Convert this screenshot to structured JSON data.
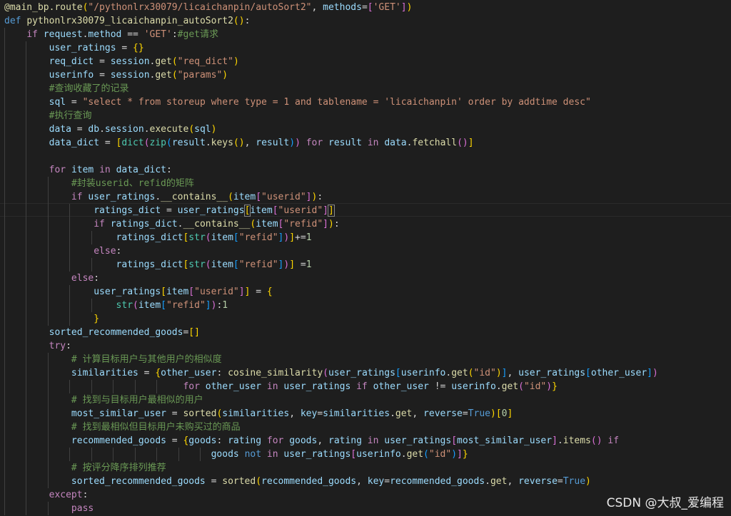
{
  "watermark": "CSDN @大叔_爱编程",
  "lines": [
    [
      [
        "dec",
        "@main_bp.route"
      ],
      [
        "bk1",
        "("
      ],
      [
        "str",
        "\"/pythonlrx30079/licaichanpin/autoSort2\""
      ],
      [
        "plain",
        ", "
      ],
      [
        "var",
        "methods"
      ],
      [
        "plain",
        "="
      ],
      [
        "bk2",
        "["
      ],
      [
        "str",
        "'GET'"
      ],
      [
        "bk2",
        "]"
      ],
      [
        "bk1",
        ")"
      ]
    ],
    [
      [
        "kw",
        "def "
      ],
      [
        "fn",
        "pythonlrx30079_licaichanpin_autoSort2"
      ],
      [
        "bk1",
        "()"
      ],
      [
        "plain",
        ":"
      ]
    ],
    [
      [
        "plain",
        "    "
      ],
      [
        "ctl",
        "if "
      ],
      [
        "var",
        "request"
      ],
      [
        "plain",
        "."
      ],
      [
        "var",
        "method"
      ],
      [
        "plain",
        " == "
      ],
      [
        "str",
        "'GET'"
      ],
      [
        "plain",
        ":"
      ],
      [
        "cmt",
        "#get请求"
      ]
    ],
    [
      [
        "plain",
        "        "
      ],
      [
        "var",
        "user_ratings"
      ],
      [
        "plain",
        " = "
      ],
      [
        "bk1",
        "{}"
      ]
    ],
    [
      [
        "plain",
        "        "
      ],
      [
        "var",
        "req_dict"
      ],
      [
        "plain",
        " = "
      ],
      [
        "var",
        "session"
      ],
      [
        "plain",
        "."
      ],
      [
        "fn",
        "get"
      ],
      [
        "bk1",
        "("
      ],
      [
        "str",
        "\"req_dict\""
      ],
      [
        "bk1",
        ")"
      ]
    ],
    [
      [
        "plain",
        "        "
      ],
      [
        "var",
        "userinfo"
      ],
      [
        "plain",
        " = "
      ],
      [
        "var",
        "session"
      ],
      [
        "plain",
        "."
      ],
      [
        "fn",
        "get"
      ],
      [
        "bk1",
        "("
      ],
      [
        "str",
        "\"params\""
      ],
      [
        "bk1",
        ")"
      ]
    ],
    [
      [
        "plain",
        "        "
      ],
      [
        "cmt",
        "#查询收藏了的记录"
      ]
    ],
    [
      [
        "plain",
        "        "
      ],
      [
        "var",
        "sql"
      ],
      [
        "plain",
        " = "
      ],
      [
        "str",
        "\"select * from storeup where type = 1 and tablename = 'licaichanpin' order by addtime desc\""
      ]
    ],
    [
      [
        "plain",
        "        "
      ],
      [
        "cmt",
        "#执行查询"
      ]
    ],
    [
      [
        "plain",
        "        "
      ],
      [
        "var",
        "data"
      ],
      [
        "plain",
        " = "
      ],
      [
        "var",
        "db"
      ],
      [
        "plain",
        "."
      ],
      [
        "var",
        "session"
      ],
      [
        "plain",
        "."
      ],
      [
        "fn",
        "execute"
      ],
      [
        "bk1",
        "("
      ],
      [
        "var",
        "sql"
      ],
      [
        "bk1",
        ")"
      ]
    ],
    [
      [
        "plain",
        "        "
      ],
      [
        "var",
        "data_dict"
      ],
      [
        "plain",
        " = "
      ],
      [
        "bk1",
        "["
      ],
      [
        "bi",
        "dict"
      ],
      [
        "bk2",
        "("
      ],
      [
        "bi",
        "zip"
      ],
      [
        "bk3",
        "("
      ],
      [
        "var",
        "result"
      ],
      [
        "plain",
        "."
      ],
      [
        "fn",
        "keys"
      ],
      [
        "bk1",
        "()"
      ],
      [
        "plain",
        ", "
      ],
      [
        "var",
        "result"
      ],
      [
        "bk3",
        ")"
      ],
      [
        "bk2",
        ")"
      ],
      [
        "plain",
        " "
      ],
      [
        "ctl",
        "for "
      ],
      [
        "var",
        "result"
      ],
      [
        "plain",
        " "
      ],
      [
        "ctl",
        "in "
      ],
      [
        "var",
        "data"
      ],
      [
        "plain",
        "."
      ],
      [
        "fn",
        "fetchall"
      ],
      [
        "bk2",
        "()"
      ],
      [
        "bk1",
        "]"
      ]
    ],
    [],
    [
      [
        "plain",
        "        "
      ],
      [
        "ctl",
        "for "
      ],
      [
        "var",
        "item"
      ],
      [
        "plain",
        " "
      ],
      [
        "ctl",
        "in "
      ],
      [
        "var",
        "data_dict"
      ],
      [
        "plain",
        ":"
      ]
    ],
    [
      [
        "plain",
        "            "
      ],
      [
        "cmt",
        "#封装userid、refid的矩阵"
      ]
    ],
    [
      [
        "plain",
        "            "
      ],
      [
        "ctl",
        "if "
      ],
      [
        "var",
        "user_ratings"
      ],
      [
        "plain",
        "."
      ],
      [
        "fn",
        "__contains__"
      ],
      [
        "bk1",
        "("
      ],
      [
        "var",
        "item"
      ],
      [
        "bk2",
        "["
      ],
      [
        "str",
        "\"userid\""
      ],
      [
        "bk2",
        "]"
      ],
      [
        "bk1",
        ")"
      ],
      [
        "plain",
        ":"
      ]
    ],
    [
      [
        "plain",
        "                "
      ],
      [
        "var",
        "ratings_dict"
      ],
      [
        "plain",
        " = "
      ],
      [
        "var",
        "user_ratings"
      ],
      [
        "bk1box",
        "["
      ],
      [
        "var",
        "item"
      ],
      [
        "bk2",
        "["
      ],
      [
        "str",
        "\"userid\""
      ],
      [
        "bk2",
        "]"
      ],
      [
        "bk1box",
        "]"
      ]
    ],
    [
      [
        "plain",
        "                "
      ],
      [
        "ctl",
        "if "
      ],
      [
        "var",
        "ratings_dict"
      ],
      [
        "plain",
        "."
      ],
      [
        "fn",
        "__contains__"
      ],
      [
        "bk1",
        "("
      ],
      [
        "var",
        "item"
      ],
      [
        "bk2",
        "["
      ],
      [
        "str",
        "\"refid\""
      ],
      [
        "bk2",
        "]"
      ],
      [
        "bk1",
        ")"
      ],
      [
        "plain",
        ":"
      ]
    ],
    [
      [
        "plain",
        "                    "
      ],
      [
        "var",
        "ratings_dict"
      ],
      [
        "bk1",
        "["
      ],
      [
        "bi",
        "str"
      ],
      [
        "bk2",
        "("
      ],
      [
        "var",
        "item"
      ],
      [
        "bk3",
        "["
      ],
      [
        "str",
        "\"refid\""
      ],
      [
        "bk3",
        "]"
      ],
      [
        "bk2",
        ")"
      ],
      [
        "bk1",
        "]"
      ],
      [
        "plain",
        "+="
      ],
      [
        "num",
        "1"
      ]
    ],
    [
      [
        "plain",
        "                "
      ],
      [
        "ctl",
        "else"
      ],
      [
        "plain",
        ":"
      ]
    ],
    [
      [
        "plain",
        "                    "
      ],
      [
        "var",
        "ratings_dict"
      ],
      [
        "bk1",
        "["
      ],
      [
        "bi",
        "str"
      ],
      [
        "bk2",
        "("
      ],
      [
        "var",
        "item"
      ],
      [
        "bk3",
        "["
      ],
      [
        "str",
        "\"refid\""
      ],
      [
        "bk3",
        "]"
      ],
      [
        "bk2",
        ")"
      ],
      [
        "bk1",
        "]"
      ],
      [
        "plain",
        " ="
      ],
      [
        "num",
        "1"
      ]
    ],
    [
      [
        "plain",
        "            "
      ],
      [
        "ctl",
        "else"
      ],
      [
        "plain",
        ":"
      ]
    ],
    [
      [
        "plain",
        "                "
      ],
      [
        "var",
        "user_ratings"
      ],
      [
        "bk1",
        "["
      ],
      [
        "var",
        "item"
      ],
      [
        "bk2",
        "["
      ],
      [
        "str",
        "\"userid\""
      ],
      [
        "bk2",
        "]"
      ],
      [
        "bk1",
        "]"
      ],
      [
        "plain",
        " = "
      ],
      [
        "bk1",
        "{"
      ]
    ],
    [
      [
        "plain",
        "                    "
      ],
      [
        "bi",
        "str"
      ],
      [
        "bk2",
        "("
      ],
      [
        "var",
        "item"
      ],
      [
        "bk3",
        "["
      ],
      [
        "str",
        "\"refid\""
      ],
      [
        "bk3",
        "]"
      ],
      [
        "bk2",
        ")"
      ],
      [
        "plain",
        ":"
      ],
      [
        "num",
        "1"
      ]
    ],
    [
      [
        "plain",
        "                "
      ],
      [
        "bk1",
        "}"
      ]
    ],
    [
      [
        "plain",
        "        "
      ],
      [
        "var",
        "sorted_recommended_goods"
      ],
      [
        "plain",
        "="
      ],
      [
        "bk1",
        "[]"
      ]
    ],
    [
      [
        "plain",
        "        "
      ],
      [
        "ctl",
        "try"
      ],
      [
        "plain",
        ":"
      ]
    ],
    [
      [
        "plain",
        "            "
      ],
      [
        "cmt",
        "# 计算目标用户与其他用户的相似度"
      ]
    ],
    [
      [
        "plain",
        "            "
      ],
      [
        "var",
        "similarities"
      ],
      [
        "plain",
        " = "
      ],
      [
        "bk1",
        "{"
      ],
      [
        "var",
        "other_user"
      ],
      [
        "plain",
        ": "
      ],
      [
        "fn",
        "cosine_similarity"
      ],
      [
        "bk2",
        "("
      ],
      [
        "var",
        "user_ratings"
      ],
      [
        "bk3",
        "["
      ],
      [
        "var",
        "userinfo"
      ],
      [
        "plain",
        "."
      ],
      [
        "fn",
        "get"
      ],
      [
        "bk1",
        "("
      ],
      [
        "str",
        "\"id\""
      ],
      [
        "bk1",
        ")"
      ],
      [
        "bk3",
        "]"
      ],
      [
        "plain",
        ", "
      ],
      [
        "var",
        "user_ratings"
      ],
      [
        "bk3",
        "["
      ],
      [
        "var",
        "other_user"
      ],
      [
        "bk3",
        "]"
      ],
      [
        "bk2",
        ")"
      ]
    ],
    [
      [
        "plain",
        "                                "
      ],
      [
        "ctl",
        "for "
      ],
      [
        "var",
        "other_user"
      ],
      [
        "plain",
        " "
      ],
      [
        "ctl",
        "in "
      ],
      [
        "var",
        "user_ratings"
      ],
      [
        "plain",
        " "
      ],
      [
        "ctl",
        "if "
      ],
      [
        "var",
        "other_user"
      ],
      [
        "plain",
        " != "
      ],
      [
        "var",
        "userinfo"
      ],
      [
        "plain",
        "."
      ],
      [
        "fn",
        "get"
      ],
      [
        "bk2",
        "("
      ],
      [
        "str",
        "\"id\""
      ],
      [
        "bk2",
        ")"
      ],
      [
        "bk1",
        "}"
      ]
    ],
    [
      [
        "plain",
        "            "
      ],
      [
        "cmt",
        "# 找到与目标用户最相似的用户"
      ]
    ],
    [
      [
        "plain",
        "            "
      ],
      [
        "var",
        "most_similar_user"
      ],
      [
        "plain",
        " = "
      ],
      [
        "fn",
        "sorted"
      ],
      [
        "bk1",
        "("
      ],
      [
        "var",
        "similarities"
      ],
      [
        "plain",
        ", "
      ],
      [
        "var",
        "key"
      ],
      [
        "plain",
        "="
      ],
      [
        "var",
        "similarities"
      ],
      [
        "plain",
        "."
      ],
      [
        "fn",
        "get"
      ],
      [
        "plain",
        ", "
      ],
      [
        "var",
        "reverse"
      ],
      [
        "plain",
        "="
      ],
      [
        "kw",
        "True"
      ],
      [
        "bk1",
        ")"
      ],
      [
        "bk1",
        "["
      ],
      [
        "num",
        "0"
      ],
      [
        "bk1",
        "]"
      ]
    ],
    [
      [
        "plain",
        "            "
      ],
      [
        "cmt",
        "# 找到最相似但目标用户未购买过的商品"
      ]
    ],
    [
      [
        "plain",
        "            "
      ],
      [
        "var",
        "recommended_goods"
      ],
      [
        "plain",
        " = "
      ],
      [
        "bk1",
        "{"
      ],
      [
        "var",
        "goods"
      ],
      [
        "plain",
        ": "
      ],
      [
        "var",
        "rating"
      ],
      [
        "plain",
        " "
      ],
      [
        "ctl",
        "for "
      ],
      [
        "var",
        "goods"
      ],
      [
        "plain",
        ", "
      ],
      [
        "var",
        "rating"
      ],
      [
        "plain",
        " "
      ],
      [
        "ctl",
        "in "
      ],
      [
        "var",
        "user_ratings"
      ],
      [
        "bk2",
        "["
      ],
      [
        "var",
        "most_similar_user"
      ],
      [
        "bk2",
        "]"
      ],
      [
        "plain",
        "."
      ],
      [
        "fn",
        "items"
      ],
      [
        "bk2",
        "()"
      ],
      [
        "plain",
        " "
      ],
      [
        "ctl",
        "if"
      ]
    ],
    [
      [
        "plain",
        "                                     "
      ],
      [
        "var",
        "goods"
      ],
      [
        "plain",
        " "
      ],
      [
        "kw",
        "not"
      ],
      [
        "plain",
        " "
      ],
      [
        "ctl",
        "in "
      ],
      [
        "var",
        "user_ratings"
      ],
      [
        "bk2",
        "["
      ],
      [
        "var",
        "userinfo"
      ],
      [
        "plain",
        "."
      ],
      [
        "fn",
        "get"
      ],
      [
        "bk3",
        "("
      ],
      [
        "str",
        "\"id\""
      ],
      [
        "bk3",
        ")"
      ],
      [
        "bk2",
        "]"
      ],
      [
        "bk1",
        "}"
      ]
    ],
    [
      [
        "plain",
        "            "
      ],
      [
        "cmt",
        "# 按评分降序排列推荐"
      ]
    ],
    [
      [
        "plain",
        "            "
      ],
      [
        "var",
        "sorted_recommended_goods"
      ],
      [
        "plain",
        " = "
      ],
      [
        "fn",
        "sorted"
      ],
      [
        "bk1",
        "("
      ],
      [
        "var",
        "recommended_goods"
      ],
      [
        "plain",
        ", "
      ],
      [
        "var",
        "key"
      ],
      [
        "plain",
        "="
      ],
      [
        "var",
        "recommended_goods"
      ],
      [
        "plain",
        "."
      ],
      [
        "fn",
        "get"
      ],
      [
        "plain",
        ", "
      ],
      [
        "var",
        "reverse"
      ],
      [
        "plain",
        "="
      ],
      [
        "kw",
        "True"
      ],
      [
        "bk1",
        ")"
      ]
    ],
    [
      [
        "plain",
        "        "
      ],
      [
        "ctl",
        "except"
      ],
      [
        "plain",
        ":"
      ]
    ],
    [
      [
        "plain",
        "            "
      ],
      [
        "ctl",
        "pass"
      ]
    ]
  ]
}
